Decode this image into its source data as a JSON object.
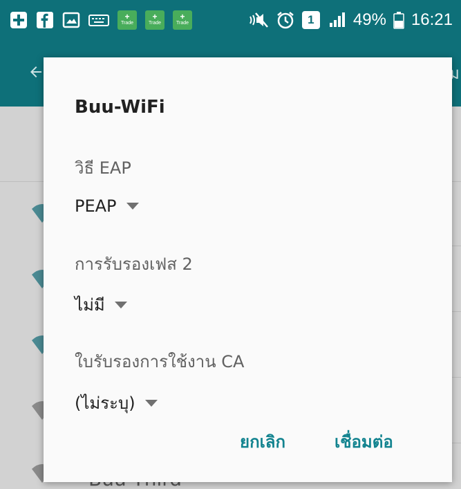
{
  "status_bar": {
    "icons": [
      "plus-square-icon",
      "facebook-icon",
      "image-icon",
      "keyboard-icon",
      "trade-app-icon",
      "trade-app-icon",
      "trade-app-icon",
      "mute-icon",
      "alarm-icon",
      "sim-1-icon",
      "signal-icon",
      "battery-icon"
    ],
    "trade_label": "Trade",
    "sim_label": "1",
    "battery": "49%",
    "time": "16:21"
  },
  "app_bar": {
    "right_text": "ดิม"
  },
  "background": {
    "last_network": "Buu Third"
  },
  "dialog": {
    "title": "Buu-WiFi",
    "eap_label": "วิธี EAP",
    "eap_value": "PEAP",
    "phase2_label": "การรับรองเฟส 2",
    "phase2_value": "ไม่มี",
    "ca_label": "ใบรับรองการใช้งาน CA",
    "ca_value": "(ไม่ระบุ)",
    "cancel_label": "ยกเลิก",
    "connect_label": "เชื่อมต่อ"
  },
  "colors": {
    "primary": "#0e7079",
    "accent": "#12838f",
    "dialog_bg": "#fafafa"
  }
}
